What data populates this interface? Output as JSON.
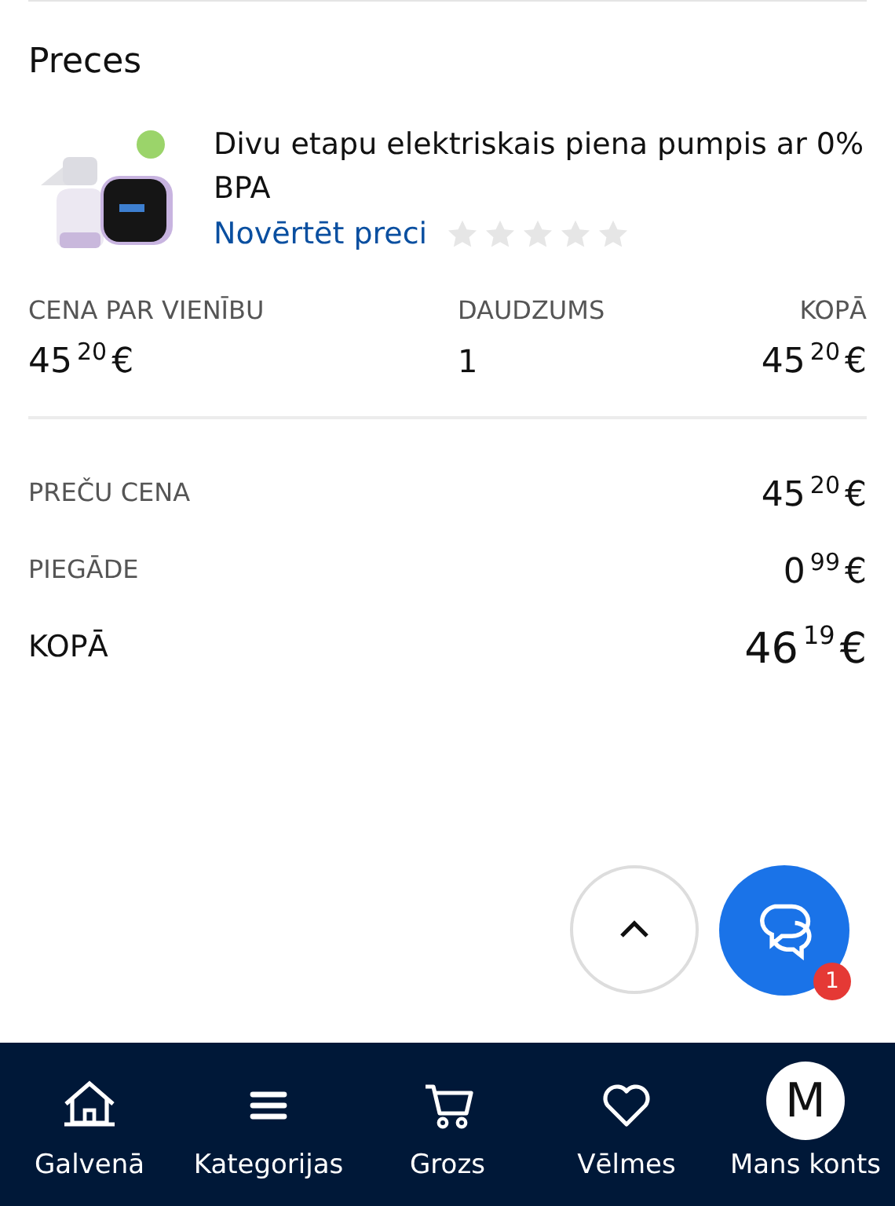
{
  "section_title": "Preces",
  "product": {
    "kind": "picture",
    "title": "Divu etapu elektriskais piena pumpis ar 0% BPA",
    "rate_link": "Novērtēt preci",
    "stars": 0
  },
  "columns": [
    {
      "label": "CENA PAR VIENĪBU",
      "value": {
        "kind": "price",
        "amount": "45",
        "cents": "20",
        "currency": "€"
      }
    },
    {
      "label": "DAUDZUMS",
      "value": {
        "kind": "plain",
        "text": "1"
      }
    },
    {
      "label": "KOPĀ",
      "value": {
        "kind": "price",
        "amount": "45",
        "cents": "20",
        "currency": "€"
      }
    }
  ],
  "summary": [
    {
      "label": "PREČU CENA",
      "kind": "normal",
      "amount": "45",
      "cents": "20",
      "currency": "€"
    },
    {
      "label": "PIEGĀDE",
      "kind": "normal",
      "amount": "0",
      "cents": "99",
      "currency": "€"
    },
    {
      "label": "KOPĀ",
      "kind": "total",
      "amount": "46",
      "cents": "19",
      "currency": "€"
    }
  ],
  "chat_badge": "1",
  "nav": [
    {
      "kind": "icon",
      "label": "Galvenā"
    },
    {
      "kind": "icon",
      "label": "Kategorijas"
    },
    {
      "kind": "icon",
      "label": "Grozs"
    },
    {
      "kind": "icon",
      "label": "Vēlmes"
    },
    {
      "kind": "avatar",
      "avatar_letter": "M",
      "label": "Mans konts"
    }
  ]
}
